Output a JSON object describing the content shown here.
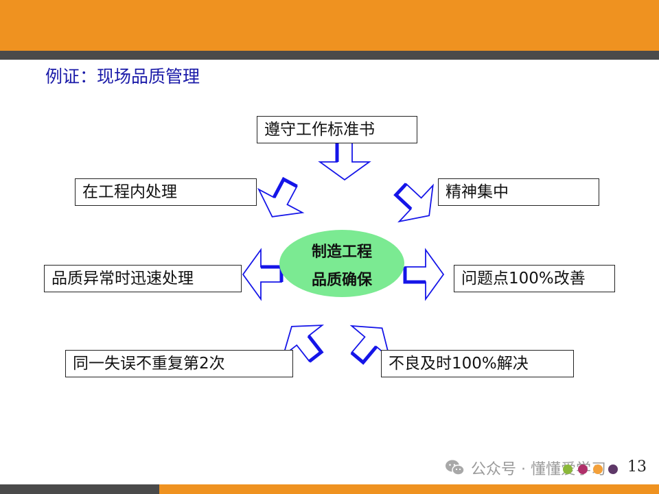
{
  "slide": {
    "title": "例证：现场品质管理",
    "page_number": "13",
    "colors": {
      "accent": "#EF9220",
      "dark": "#4A4A4A",
      "arrow": "#1515E8",
      "center_fill": "#7BEA92",
      "title": "#1a1aa8"
    }
  },
  "center": {
    "line1": "制造工程",
    "line2": "品质确保"
  },
  "boxes": {
    "top": "遵守工作标准书",
    "upper_left": "在工程内处理",
    "upper_right": "精神集中",
    "mid_left": "品质异常时迅速处理",
    "mid_right": "问题点100%改善",
    "lower_left": "同一失误不重复第2次",
    "lower_right": "不良及时100%解决"
  },
  "footer": {
    "watermark": "公众号 · 懂懂爱学习",
    "icon": "wechat-icon",
    "dot_colors": [
      "#8BB83A",
      "#B0306A",
      "#F3A03A",
      "#5E3868"
    ]
  }
}
